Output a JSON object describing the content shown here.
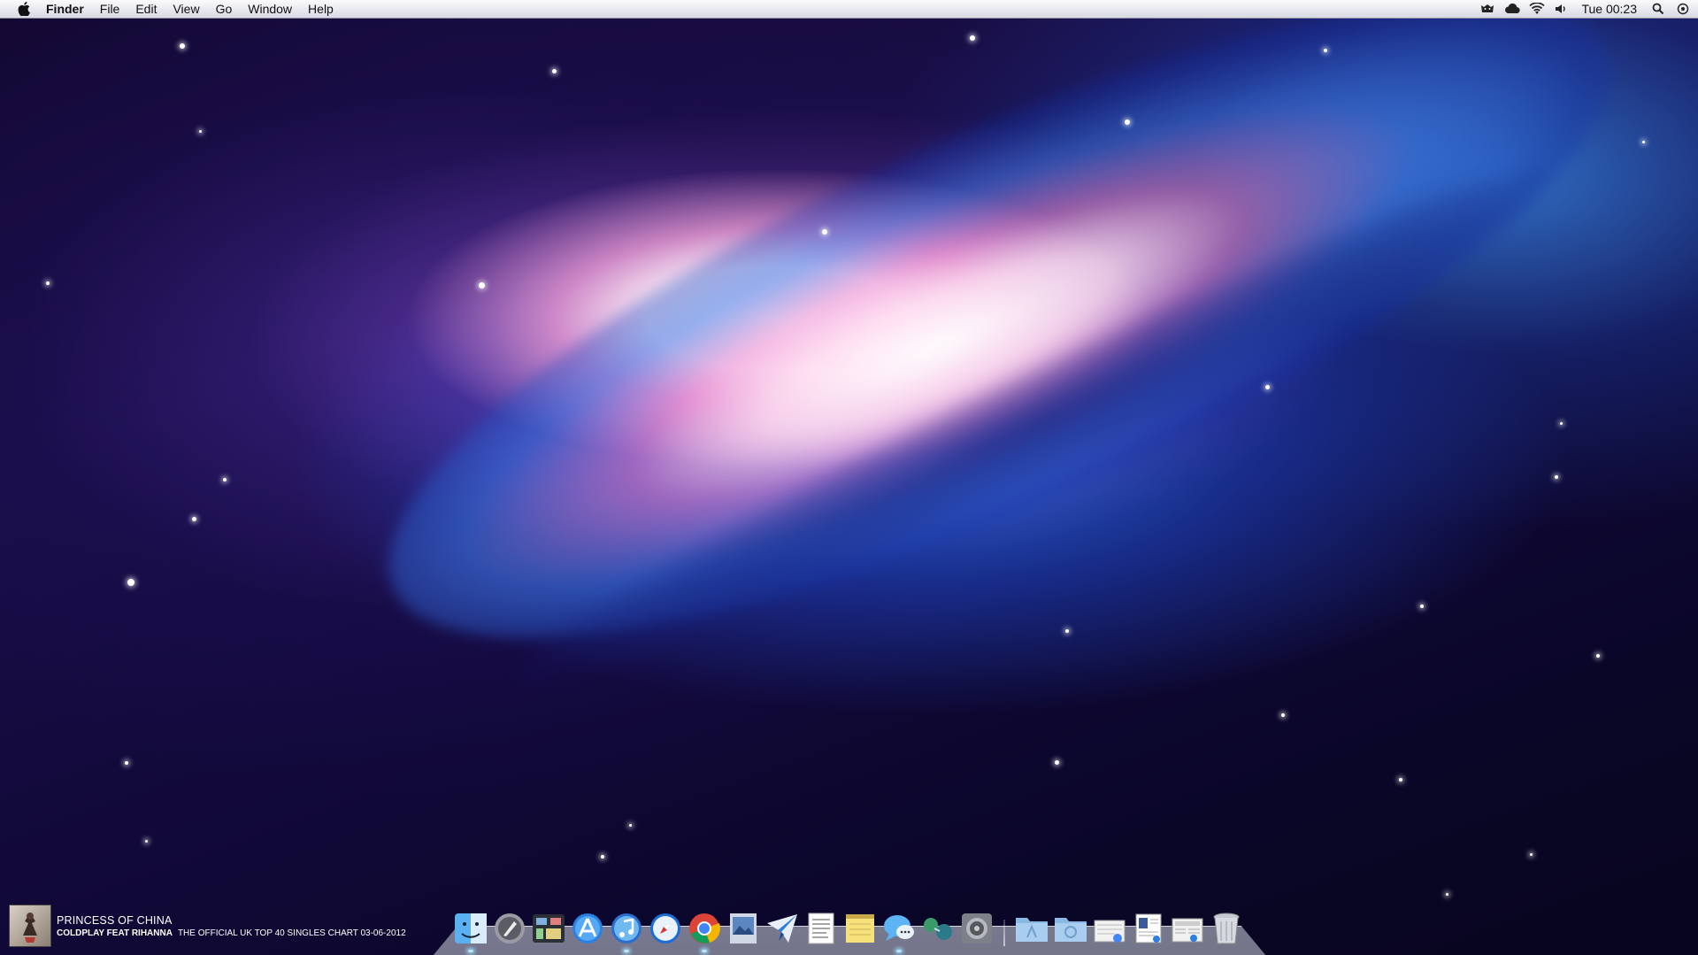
{
  "menubar": {
    "app_name": "Finder",
    "menus": [
      "File",
      "Edit",
      "View",
      "Go",
      "Window",
      "Help"
    ],
    "clock": "Tue 00:23",
    "status_icons": [
      "growl-icon",
      "icloud-icon",
      "wifi-icon",
      "volume-icon",
      "spotlight-icon",
      "notification-icon"
    ]
  },
  "now_playing": {
    "title": "PRINCESS OF CHINA",
    "artist": "COLDPLAY FEAT RIHANNA",
    "source": "THE OFFICIAL UK TOP 40 SINGLES CHART 03-06-2012"
  },
  "dock": {
    "apps": [
      {
        "name": "finder-icon",
        "running": true
      },
      {
        "name": "launchpad-icon",
        "running": false
      },
      {
        "name": "mission-control-icon",
        "running": false
      },
      {
        "name": "app-store-icon",
        "running": false
      },
      {
        "name": "itunes-icon",
        "running": true
      },
      {
        "name": "safari-icon",
        "running": false
      },
      {
        "name": "chrome-icon",
        "running": true
      },
      {
        "name": "preview-icon",
        "running": false
      },
      {
        "name": "mail-icon",
        "running": false
      },
      {
        "name": "textedit-icon",
        "running": false
      },
      {
        "name": "notes-icon",
        "running": false
      },
      {
        "name": "messages-icon",
        "running": true
      },
      {
        "name": "network-icon",
        "running": false
      },
      {
        "name": "system-preferences-icon",
        "running": false
      }
    ],
    "stacks": [
      "applications-folder-icon",
      "downloads-folder-icon",
      "document-stack-icon",
      "screenshot-stack-icon",
      "web-document-icon",
      "trash-icon"
    ]
  },
  "colors": {
    "menubar_bg": "#e8e8ef",
    "accent_blue": "#2a6fe0",
    "galaxy_pink": "#f0a0d8"
  }
}
